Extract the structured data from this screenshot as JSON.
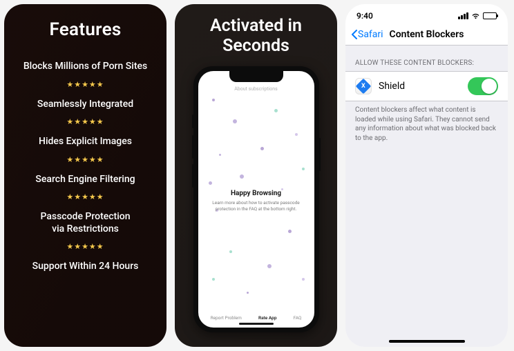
{
  "panel1": {
    "title": "Features",
    "features": [
      "Blocks Millions of Porn Sites",
      "Seamlessly Integrated",
      "Hides Explicit Images",
      "Search Engine Filtering",
      "Passcode Protection\nvia Restrictions",
      "Support Within 24 Hours"
    ],
    "stars": "★★★★★"
  },
  "panel2": {
    "title": "Activated in\nSeconds",
    "top_link": "About subscriptions",
    "mid_title": "Happy Browsing",
    "mid_sub": "Learn more about how to activate passcode protection in the FAQ at the bottom right.",
    "tabs": {
      "left": "Report Problem",
      "mid": "Rate App",
      "right": "FAQ"
    }
  },
  "panel3": {
    "time": "9:40",
    "back_label": "Safari",
    "nav_title": "Content Blockers",
    "section_header": "ALLOW THESE CONTENT BLOCKERS:",
    "row": {
      "label": "Shield",
      "icon_letter": "X",
      "enabled": true
    },
    "footer": "Content blockers affect what content is loaded while using Safari. They cannot send any information about what was blocked back to the app."
  }
}
